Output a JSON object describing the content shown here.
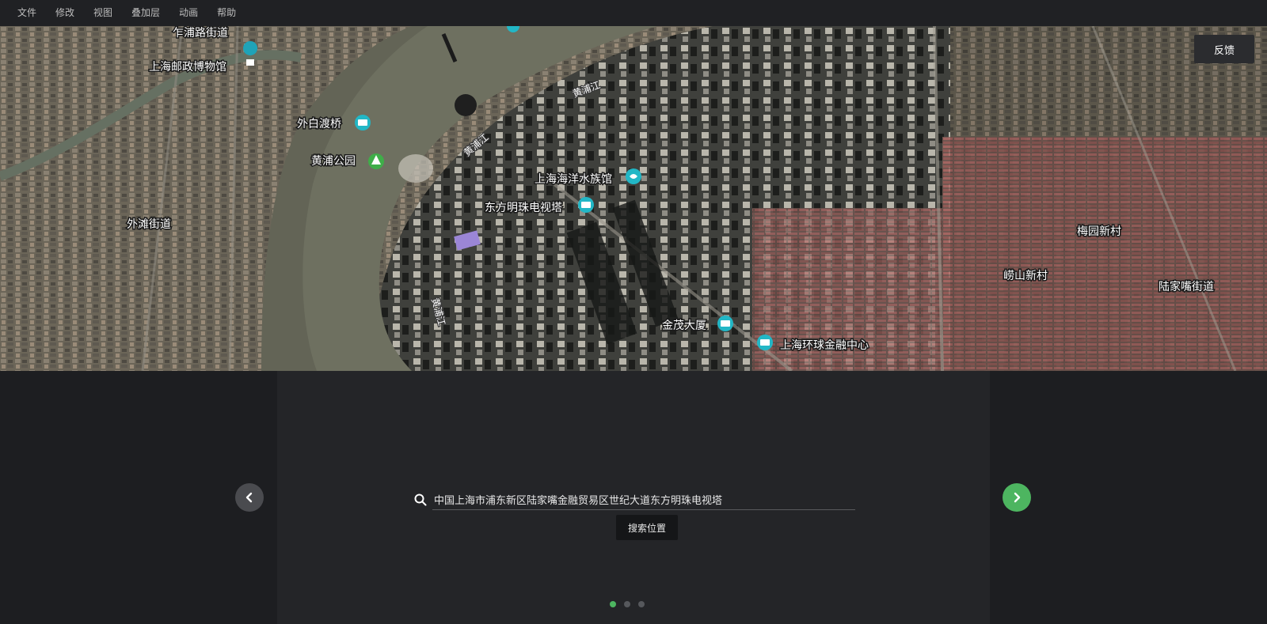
{
  "menu": [
    "文件",
    "修改",
    "视图",
    "叠加层",
    "动画",
    "帮助"
  ],
  "feedback_label": "反馈",
  "map": {
    "labels": [
      {
        "id": "zhapu",
        "text": "乍浦路街道"
      },
      {
        "id": "post-museum",
        "text": "上海邮政博物馆"
      },
      {
        "id": "waibaidu",
        "text": "外白渡桥"
      },
      {
        "id": "huangpu-park",
        "text": "黄浦公园"
      },
      {
        "id": "waitan",
        "text": "外滩街道"
      },
      {
        "id": "aquarium",
        "text": "上海海洋水族馆"
      },
      {
        "id": "pearl-tower",
        "text": "东方明珠电视塔"
      },
      {
        "id": "jinmao",
        "text": "金茂大厦"
      },
      {
        "id": "swfc",
        "text": "上海环球金融中心"
      },
      {
        "id": "meiyuan",
        "text": "梅园新村"
      },
      {
        "id": "laoshan",
        "text": "崂山新村"
      },
      {
        "id": "lujiazui",
        "text": "陆家嘴街道"
      }
    ],
    "river_labels": [
      "黄浦江",
      "黄浦江",
      "黄浦江"
    ]
  },
  "search": {
    "value": "中国上海市浦东新区陆家嘴金融贸易区世纪大道东方明珠电视塔",
    "button_label": "搜索位置"
  },
  "pagination": {
    "count": 3,
    "active": 0
  },
  "colors": {
    "accent": "#4db560",
    "background": "#1d1e21",
    "panel": "#242528"
  }
}
